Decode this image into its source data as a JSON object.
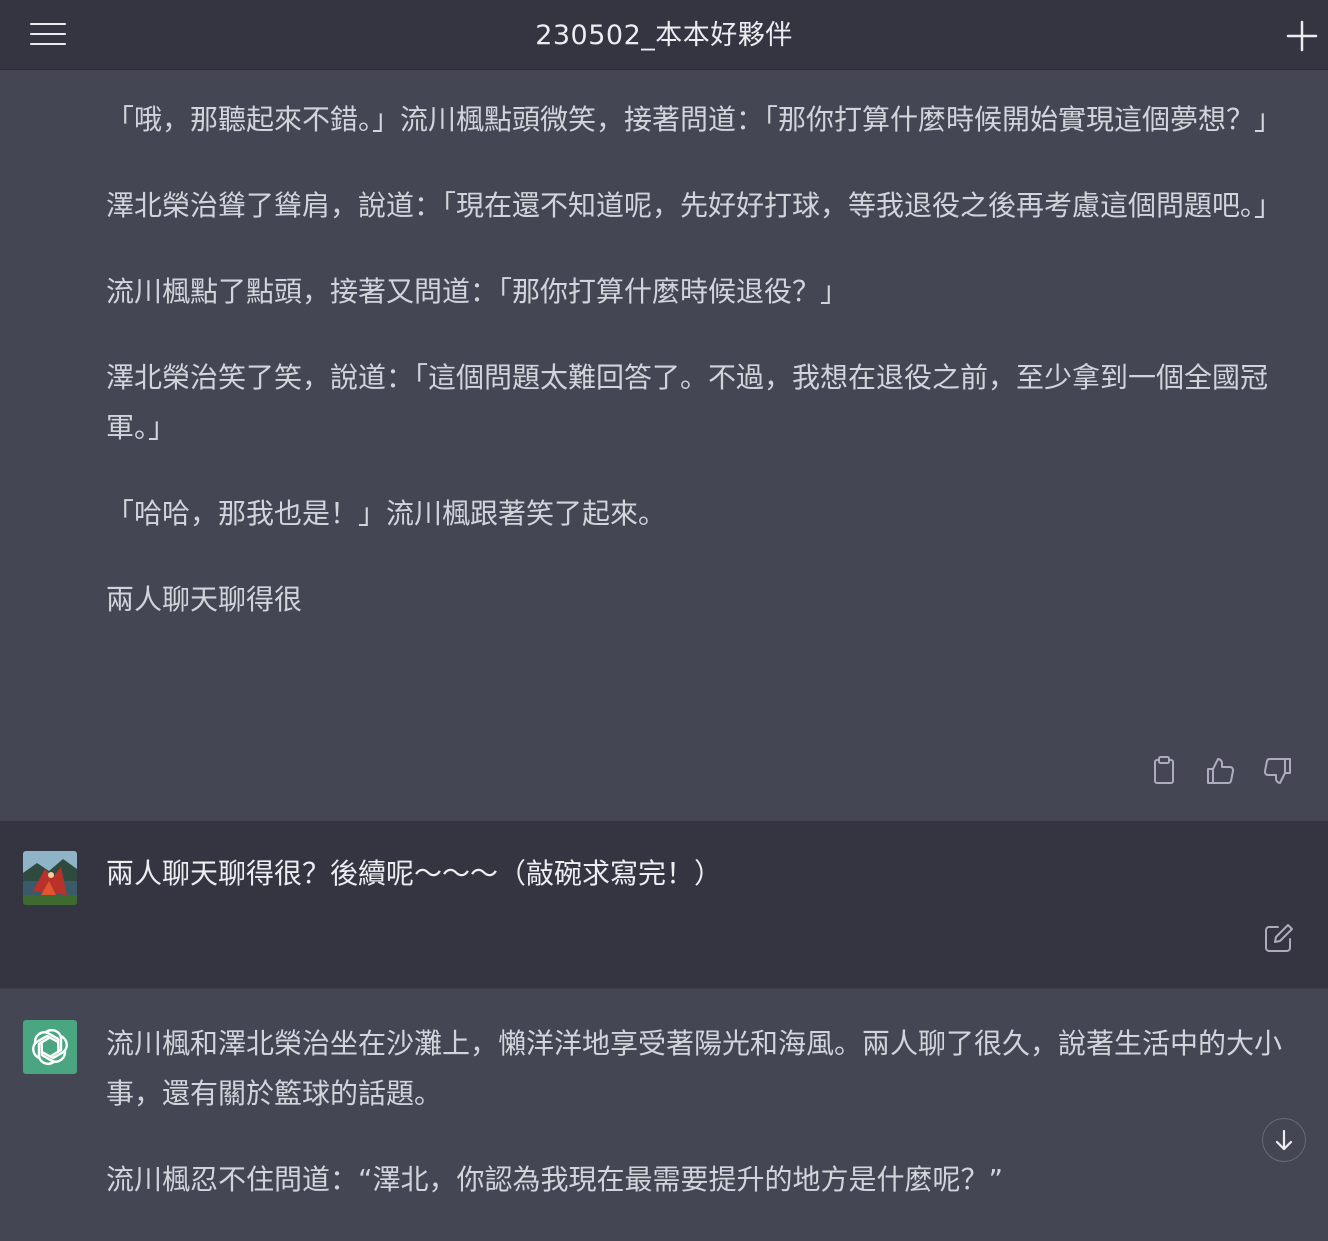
{
  "header": {
    "title": "230502_本本好夥伴",
    "menu_icon": "hamburger-menu-icon",
    "new_chat_icon": "plus-icon"
  },
  "messages": [
    {
      "role": "assistant",
      "paragraphs": [
        "「哦，那聽起來不錯。」流川楓點頭微笑，接著問道：「那你打算什麼時候開始實現這個夢想？」",
        "澤北榮治聳了聳肩，說道：「現在還不知道呢，先好好打球，等我退役之後再考慮這個問題吧。」",
        "流川楓點了點頭，接著又問道：「那你打算什麼時候退役？」",
        "澤北榮治笑了笑，說道：「這個問題太難回答了。不過，我想在退役之前，至少拿到一個全國冠軍。」",
        "「哈哈，那我也是！」流川楓跟著笑了起來。",
        "兩人聊天聊得很"
      ],
      "actions": [
        "clipboard-icon",
        "thumbs-up-icon",
        "thumbs-down-icon"
      ]
    },
    {
      "role": "user",
      "text": "兩人聊天聊得很？後續呢～～～（敲碗求寫完！）",
      "actions": [
        "edit-icon"
      ]
    },
    {
      "role": "assistant",
      "paragraphs": [
        "流川楓和澤北榮治坐在沙灘上，懶洋洋地享受著陽光和海風。兩人聊了很久，說著生活中的大小事，還有關於籃球的話題。",
        "流川楓忍不住問道：“澤北，你認為我現在最需要提升的地方是什麼呢？”"
      ]
    }
  ],
  "scroll_button_icon": "arrow-down-icon",
  "colors": {
    "assistant_bg": "#444654",
    "user_bg": "#343541",
    "gpt_avatar": "#4aa581"
  }
}
